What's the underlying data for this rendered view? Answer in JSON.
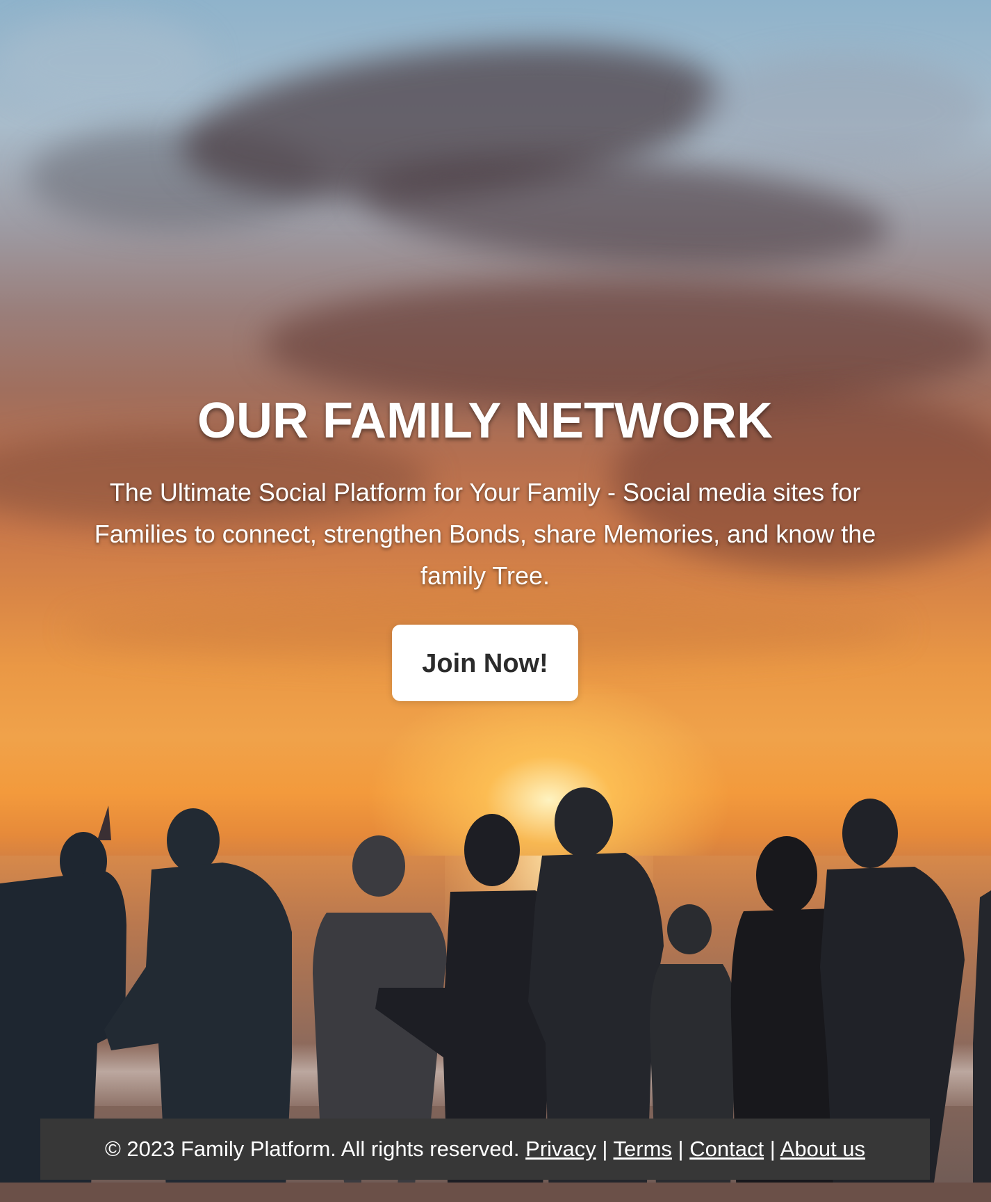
{
  "hero": {
    "title": "OUR FAMILY NETWORK",
    "subtitle": "The Ultimate Social Platform for Your Family - Social media sites for Families to connect, strengthen Bonds, share Memories, and know the family Tree.",
    "cta_label": "Join Now!"
  },
  "footer": {
    "copyright": "© 2023 Family Platform. All rights reserved.",
    "separator": "|",
    "links": {
      "privacy": "Privacy",
      "terms": "Terms",
      "contact": "Contact",
      "about": "About us"
    }
  },
  "colors": {
    "footer_background": "#373737",
    "button_background": "#ffffff",
    "button_text": "#2b2b2b",
    "hero_text": "#ffffff"
  }
}
